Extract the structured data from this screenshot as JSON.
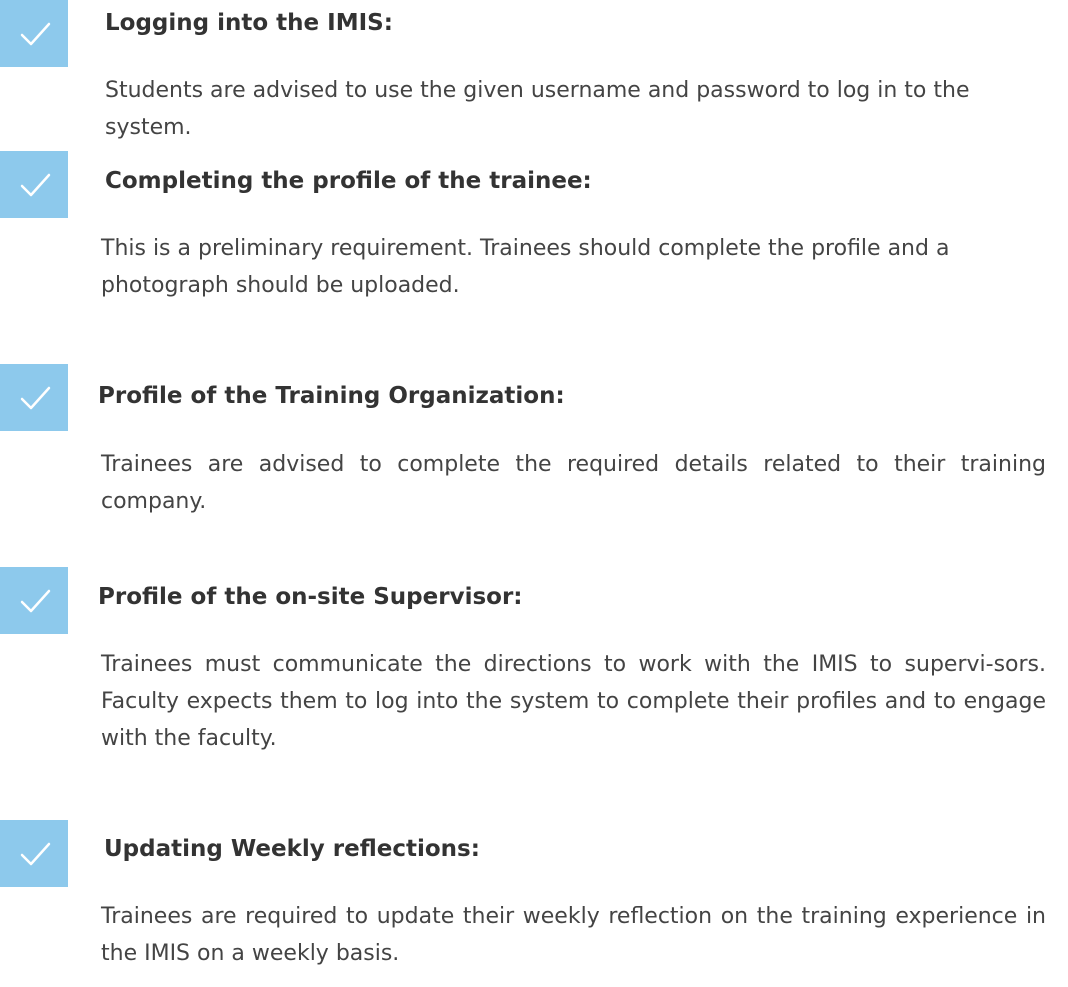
{
  "colors": {
    "check_box": "#8dc9ec",
    "check_mark": "#ffffff",
    "title_text": "#333333",
    "body_text": "#444444"
  },
  "items": [
    {
      "icon": "checkmark-icon",
      "title": "Logging into the IMIS:",
      "body": "Students are advised to use the given username and password to log in to the system."
    },
    {
      "icon": "checkmark-icon",
      "title": "Completing the profile of the trainee:",
      "body": "This is a preliminary requirement. Trainees should complete the profile and a photograph should be uploaded."
    },
    {
      "icon": "checkmark-icon",
      "title": "Profile of the Training Organization:",
      "body": "Trainees are advised to complete the required details related to their training company."
    },
    {
      "icon": "checkmark-icon",
      "title": "Profile of the on-site Supervisor:",
      "body": "Trainees must communicate the directions to work with the IMIS to supervi-sors. Faculty expects them to log into the system to complete their profiles and to engage with the faculty."
    },
    {
      "icon": "checkmark-icon",
      "title": "Updating Weekly reflections:",
      "body": "Trainees are required to update their weekly reflection on the training experience in the IMIS on a weekly basis."
    }
  ]
}
